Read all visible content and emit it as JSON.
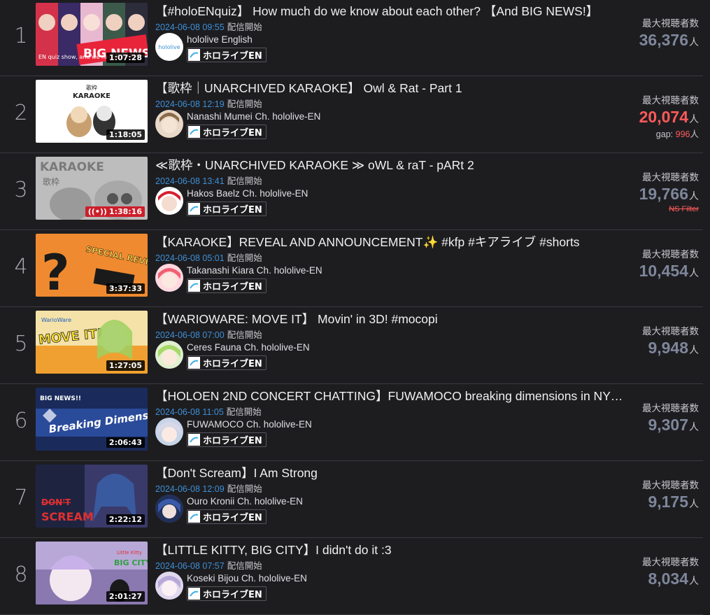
{
  "stat_label": "最大視聴者数",
  "unit": "人",
  "start_suffix": "配信開始",
  "badge_label": "ホロライブEN",
  "gap_label": "gap:",
  "ns_filter_label": "NS Filter",
  "colors": {
    "accent_blue": "#3d8fd6",
    "hot_red": "#ff5a5a",
    "muted_value": "#7e869a"
  },
  "rows": [
    {
      "rank": "1",
      "title": "【#holoENquiz】 How much do we know about each other? 【And BIG NEWS!】",
      "date": "2024-06-08 09:55",
      "channel": "hololive English",
      "duration": "1:07:28",
      "viewers": "36,376",
      "thumb_text": "BIG NEWS!?",
      "thumb_subtext": "EN quiz show, and we have"
    },
    {
      "rank": "2",
      "title": "【歌枠｜UNARCHIVED KARAOKE】 Owl & Rat - Part 1",
      "date": "2024-06-08 12:19",
      "channel": "Nanashi Mumei Ch. hololive-EN",
      "duration": "1:18:05",
      "viewers": "20,074",
      "gap_value": "996",
      "thumb_text": "KARAOKE",
      "thumb_subtext": "歌枠"
    },
    {
      "rank": "3",
      "title": "≪歌枠・UNARCHIVED KARAOKE ≫ oWL & raT - pARt 2",
      "date": "2024-06-08 13:41",
      "channel": "Hakos Baelz Ch. hololive-EN",
      "duration": "1:38:16",
      "viewers": "19,766",
      "thumb_text": "KARAOKE",
      "thumb_subtext": "歌枠"
    },
    {
      "rank": "4",
      "title": "【KARAOKE】REVEAL AND ANNOUNCEMENT✨ #kfp #キアライブ #shorts",
      "date": "2024-06-08 05:01",
      "channel": "Takanashi Kiara Ch. hololive-EN",
      "duration": "3:37:33",
      "viewers": "10,454",
      "thumb_text": "SPECIAL REVEAL",
      "thumb_subtext": "?"
    },
    {
      "rank": "5",
      "title": "【WARIOWARE: MOVE IT】 Movin' in 3D! #mocopi",
      "date": "2024-06-08 07:00",
      "channel": "Ceres Fauna Ch. hololive-EN",
      "duration": "1:27:05",
      "viewers": "9,948",
      "thumb_text": "MOVE IT!",
      "thumb_subtext": "WarioWare"
    },
    {
      "rank": "6",
      "title": "【HOLOEN 2ND CONCERT CHATTING】FUWAMOCO breaking dimensions in NYC…",
      "date": "2024-06-08 11:05",
      "channel": "FUWAMOCO Ch. hololive-EN",
      "duration": "2:06:43",
      "viewers": "9,307",
      "thumb_text": "Breaking Dimensions",
      "thumb_subtext": "BIG NEWS!!"
    },
    {
      "rank": "7",
      "title": "【Don't Scream】I Am Strong",
      "date": "2024-06-08 12:09",
      "channel": "Ouro Kronii Ch. hololive-EN",
      "duration": "2:22:12",
      "viewers": "9,175",
      "thumb_text": "SCREAM",
      "thumb_subtext": "DON'T"
    },
    {
      "rank": "8",
      "title": "【LITTLE KITTY, BIG CITY】I didn't do it :3",
      "date": "2024-06-08 07:57",
      "channel": "Koseki Bijou Ch. hololive-EN",
      "duration": "2:01:27",
      "viewers": "8,034",
      "thumb_text": "BIG CITY",
      "thumb_subtext": "Little Kitty"
    }
  ]
}
